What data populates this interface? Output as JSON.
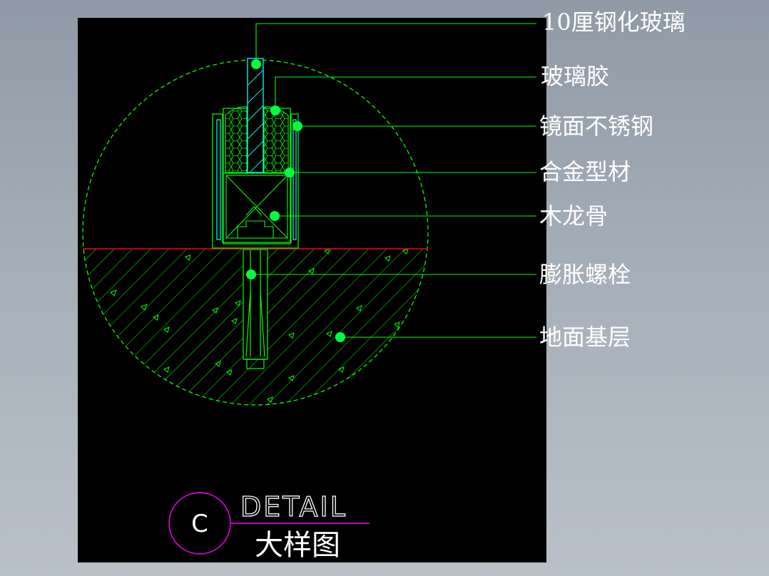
{
  "drawing": {
    "labels": {
      "tempered_glass": "10厘钢化玻璃",
      "glass_glue": "玻璃胶",
      "mirror_steel": "镜面不锈钢",
      "alloy_profile": "合金型材",
      "wood_keel": "木龙骨",
      "expansion_bolt": "膨胀螺栓",
      "ground_base": "地面基层"
    },
    "title_block": {
      "letter": "C",
      "detail": "DETAIL",
      "subtitle": "大样图"
    }
  },
  "colors": {
    "background": "#000000",
    "linework": "#00ff00",
    "marker": "#00ff3c",
    "glass": "#00ffff",
    "ground_line": "#ff0000",
    "title_circle": "#ff00ff",
    "text": "#ffffff"
  }
}
